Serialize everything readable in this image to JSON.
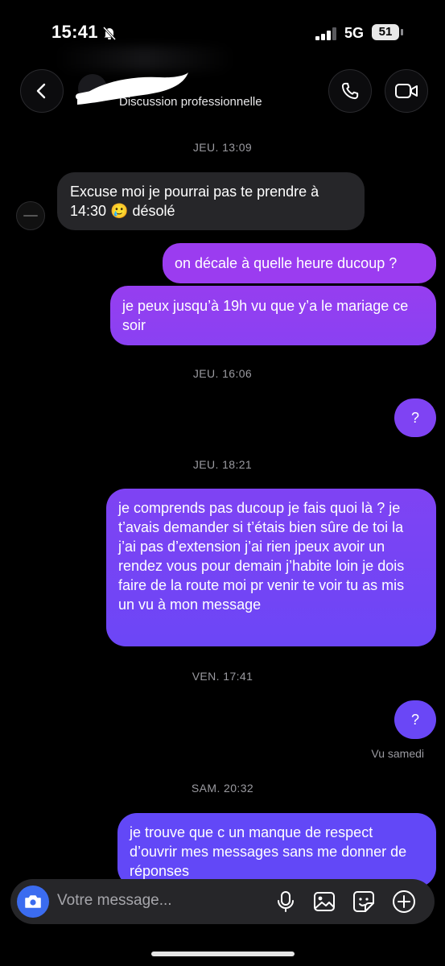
{
  "status_bar": {
    "time": "15:41",
    "network": "5G",
    "battery": "51"
  },
  "header": {
    "subtitle": "Discussion professionnelle"
  },
  "messages": [
    {
      "type": "timestamp",
      "text": "JEU. 13:09"
    },
    {
      "type": "incoming",
      "text": "Excuse moi je pourrai pas te prendre à 14:30 🥲 désolé"
    },
    {
      "type": "outgoing",
      "text": "on décale à quelle heure ducoup ?"
    },
    {
      "type": "outgoing",
      "text": "je peux jusqu’à 19h vu que y’a le mariage ce soir"
    },
    {
      "type": "timestamp",
      "text": "JEU. 16:06"
    },
    {
      "type": "outgoing",
      "text": "?"
    },
    {
      "type": "timestamp",
      "text": "JEU. 18:21"
    },
    {
      "type": "outgoing",
      "text": "je comprends pas ducoup je fais quoi là ? je t’avais demander si t’étais bien sûre de toi la j’ai pas d’extension j’ai rien jpeux avoir un rendez vous pour demain j’habite loin je dois faire de la route moi pr venir te voir tu as mis un vu à mon message"
    },
    {
      "type": "timestamp",
      "text": "VEN. 17:41"
    },
    {
      "type": "outgoing",
      "text": "?"
    },
    {
      "type": "seen",
      "text": "Vu samedi"
    },
    {
      "type": "timestamp",
      "text": "SAM. 20:32"
    },
    {
      "type": "outgoing",
      "text": "je trouve que c un manque de respect d’ouvrir mes messages sans me donner de réponses"
    }
  ],
  "composer": {
    "placeholder": "Votre message..."
  },
  "colors": {
    "outgoing_top": "#a23bf0",
    "outgoing_bottom": "#6a45f5",
    "incoming": "#262629",
    "accent": "#3b6cf0"
  },
  "icons": [
    "bell-off-icon",
    "back-chevron-icon",
    "phone-icon",
    "video-icon",
    "camera-icon",
    "mic-icon",
    "image-icon",
    "sticker-icon",
    "plus-icon"
  ]
}
